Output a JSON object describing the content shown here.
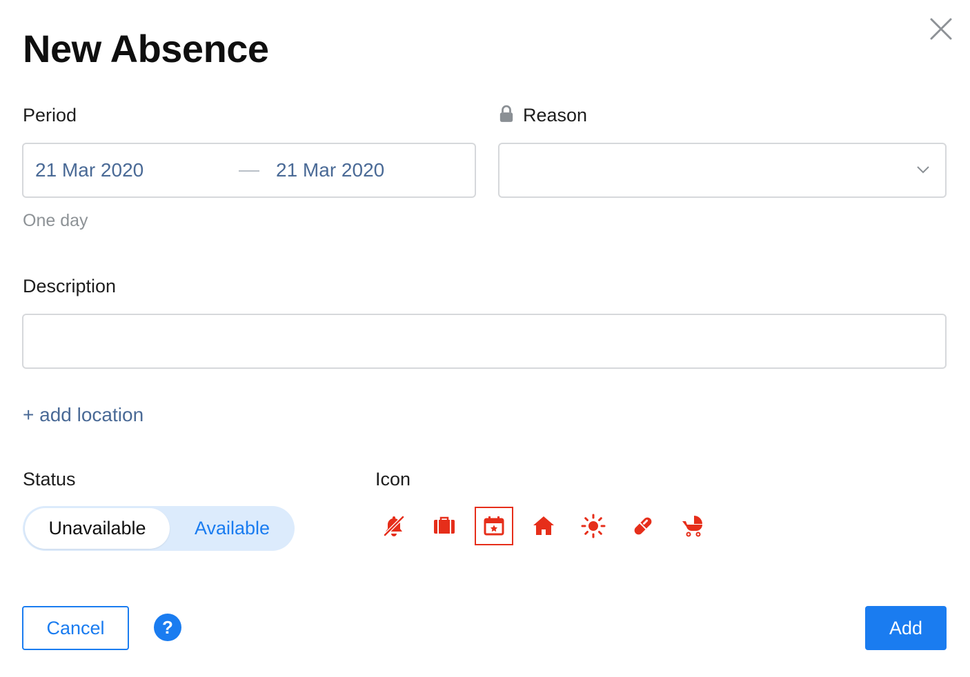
{
  "dialog": {
    "title": "New Absence",
    "close_icon": "close-icon"
  },
  "period": {
    "label": "Period",
    "start": "21 Mar 2020",
    "end": "21 Mar 2020",
    "hint": "One day"
  },
  "reason": {
    "label": "Reason",
    "icon": "lock-icon",
    "value": ""
  },
  "description": {
    "label": "Description",
    "value": ""
  },
  "location": {
    "add_label": "+ add location"
  },
  "status": {
    "label": "Status",
    "options": [
      "Unavailable",
      "Available"
    ],
    "selected": "Unavailable"
  },
  "icon_picker": {
    "label": "Icon",
    "options": [
      "bell-slash-icon",
      "suitcase-icon",
      "calendar-star-icon",
      "home-icon",
      "sun-icon",
      "pill-icon",
      "baby-carriage-icon"
    ],
    "selected": "calendar-star-icon",
    "color": "#e62e1a"
  },
  "footer": {
    "cancel_label": "Cancel",
    "help_label": "?",
    "add_label": "Add"
  },
  "colors": {
    "accent": "#1a7cf0",
    "date_text": "#4a6a96",
    "icon_red": "#e62e1a"
  }
}
